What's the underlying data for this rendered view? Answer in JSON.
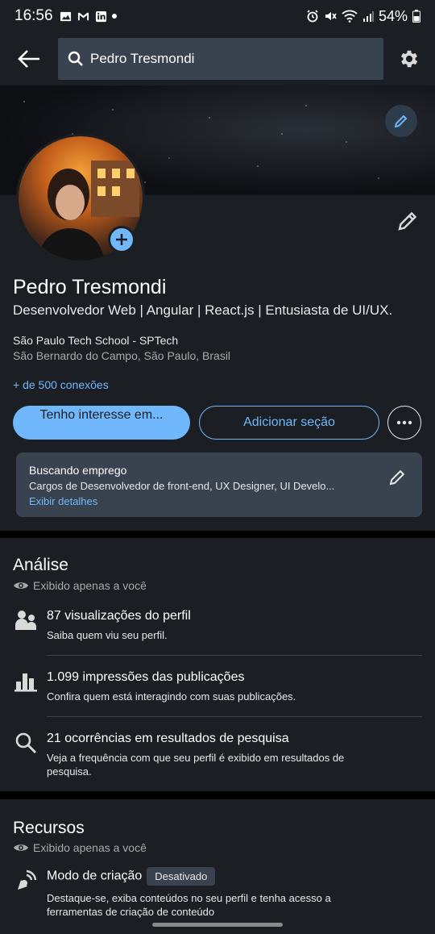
{
  "status_bar": {
    "time": "16:56",
    "battery": "54%"
  },
  "topbar": {
    "search_value": "Pedro Tresmondi",
    "icons": [
      "back-arrow-icon",
      "search-icon",
      "gear-icon"
    ]
  },
  "profile": {
    "name": "Pedro Tresmondi",
    "headline": "Desenvolvedor Web | Angular | React.js | Entusiasta de UI/UX.",
    "school": "São Paulo Tech School - SPTech",
    "location": "São Bernardo do Campo, São Paulo, Brasil",
    "connections": "+ de 500 conexões",
    "btn_interest": "Tenho interesse em...",
    "btn_add_section": "Adicionar seção"
  },
  "open_to_work": {
    "title": "Buscando emprego",
    "description": "Cargos de Desenvolvedor de front-end, UX Designer, UI Develo...",
    "link": "Exibir detalhes"
  },
  "analytics": {
    "title": "Análise",
    "private_note": "Exibido apenas a você",
    "items": [
      {
        "icon": "people-icon",
        "title": "87 visualizações do perfil",
        "subtitle": "Saiba quem viu seu perfil."
      },
      {
        "icon": "bar-chart-icon",
        "title": "1.099 impressões das publicações",
        "subtitle": "Confira quem está interagindo com suas publicações."
      },
      {
        "icon": "search-icon",
        "title": "21 ocorrências em resultados de pesquisa",
        "subtitle": "Veja a frequência com que seu perfil é exibido em resultados de pesquisa."
      }
    ]
  },
  "resources": {
    "title": "Recursos",
    "private_note": "Exibido apenas a você",
    "item": {
      "icon": "creator-mode-icon",
      "title": "Modo de criação",
      "badge": "Desativado",
      "subtitle": "Destaque-se, exiba conteúdos no seu perfil e tenha acesso a ferramentas de criação de conteúdo"
    }
  },
  "colors": {
    "background": "#1b1f23",
    "accent": "#71b7fb",
    "card": "#38434f"
  }
}
